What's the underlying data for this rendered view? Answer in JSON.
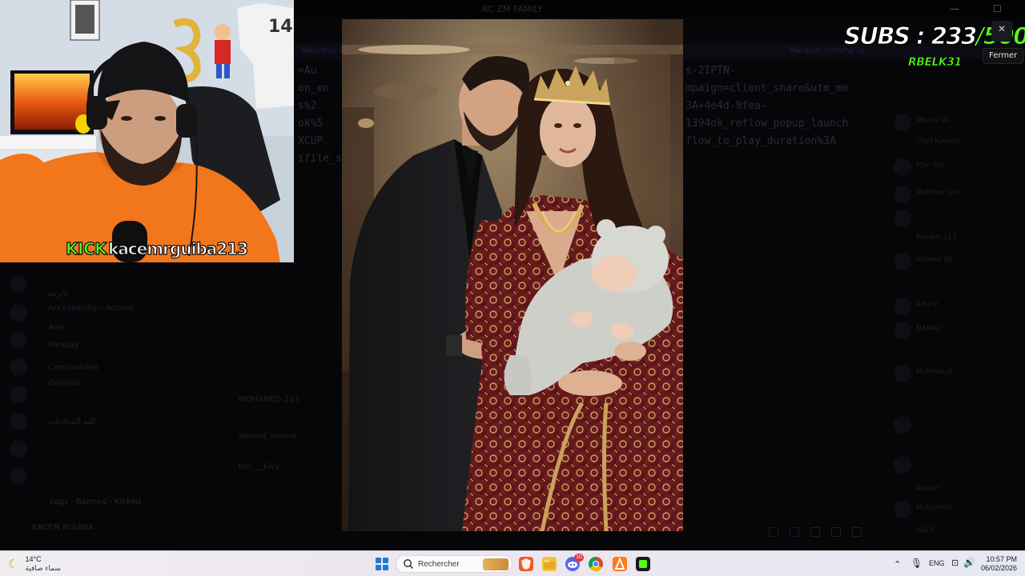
{
  "background": {
    "window_title": "RC ZM FAMILY",
    "topbar_text": "Nouveau Post",
    "topbar_right": "Marquer comme lu",
    "link_left_lines": [
      "=Au",
      "on_en",
      "s%2",
      "ok%5",
      "XCUP",
      "ifile_s"
    ],
    "link_right_lines": [
      "s-2IPTN-",
      "mpaign=client_share&utm_me",
      "3A+4e4d-9fea-",
      "1394ok_reflow_popup_launch",
      "flow_to_play_duration%3A"
    ],
    "channels": [
      "بالرتبة",
      "Accessibility - Accueil",
      "Avis",
      "Pixabay",
      "Commandes",
      "Général",
      "كلية المحادثات",
      "Logs - Banned - Kicked"
    ],
    "messages": [
      "MOHAMED 213",
      "ahmed_emma",
      "fun___klvy"
    ],
    "user_name": "KACEM RGUIBA",
    "members": [
      "Mistral AI",
      "Chef Kacem",
      "Mar_CU",
      "Member list",
      "Kacem 213",
      "Ahmed Bk",
      "Azuriz",
      "NAMAL",
      "Mahmoud",
      "ROYALTY",
      "Abderr",
      "Mohamed",
      "ALEX",
      "Ayoub"
    ]
  },
  "photo": {
    "alt": "Family portrait: man in black suit, woman in embroidered burgundy caftan with gold crown holding a baby in a bear-ear hooded outfit"
  },
  "webcam": {
    "platform": "KICK",
    "channel": "kacemrguiba213"
  },
  "subs_overlay": {
    "label": "SUBS : ",
    "current": "233",
    "separator": "/",
    "goal": "500",
    "username": "RBELK31"
  },
  "tooltip": {
    "text": "Fermer"
  },
  "taskbar": {
    "weather_temp": "14°C",
    "weather_condition": "سماء صافية",
    "search_placeholder": "Rechercher",
    "language": "ENG",
    "time": "10:57 PM",
    "date": "06/02/2026",
    "pinned_apps": [
      "brave-icon",
      "file-explorer-icon",
      "discord-icon",
      "chrome-icon",
      "app-icon",
      "kick-app-icon"
    ],
    "discord_badge": "10"
  }
}
